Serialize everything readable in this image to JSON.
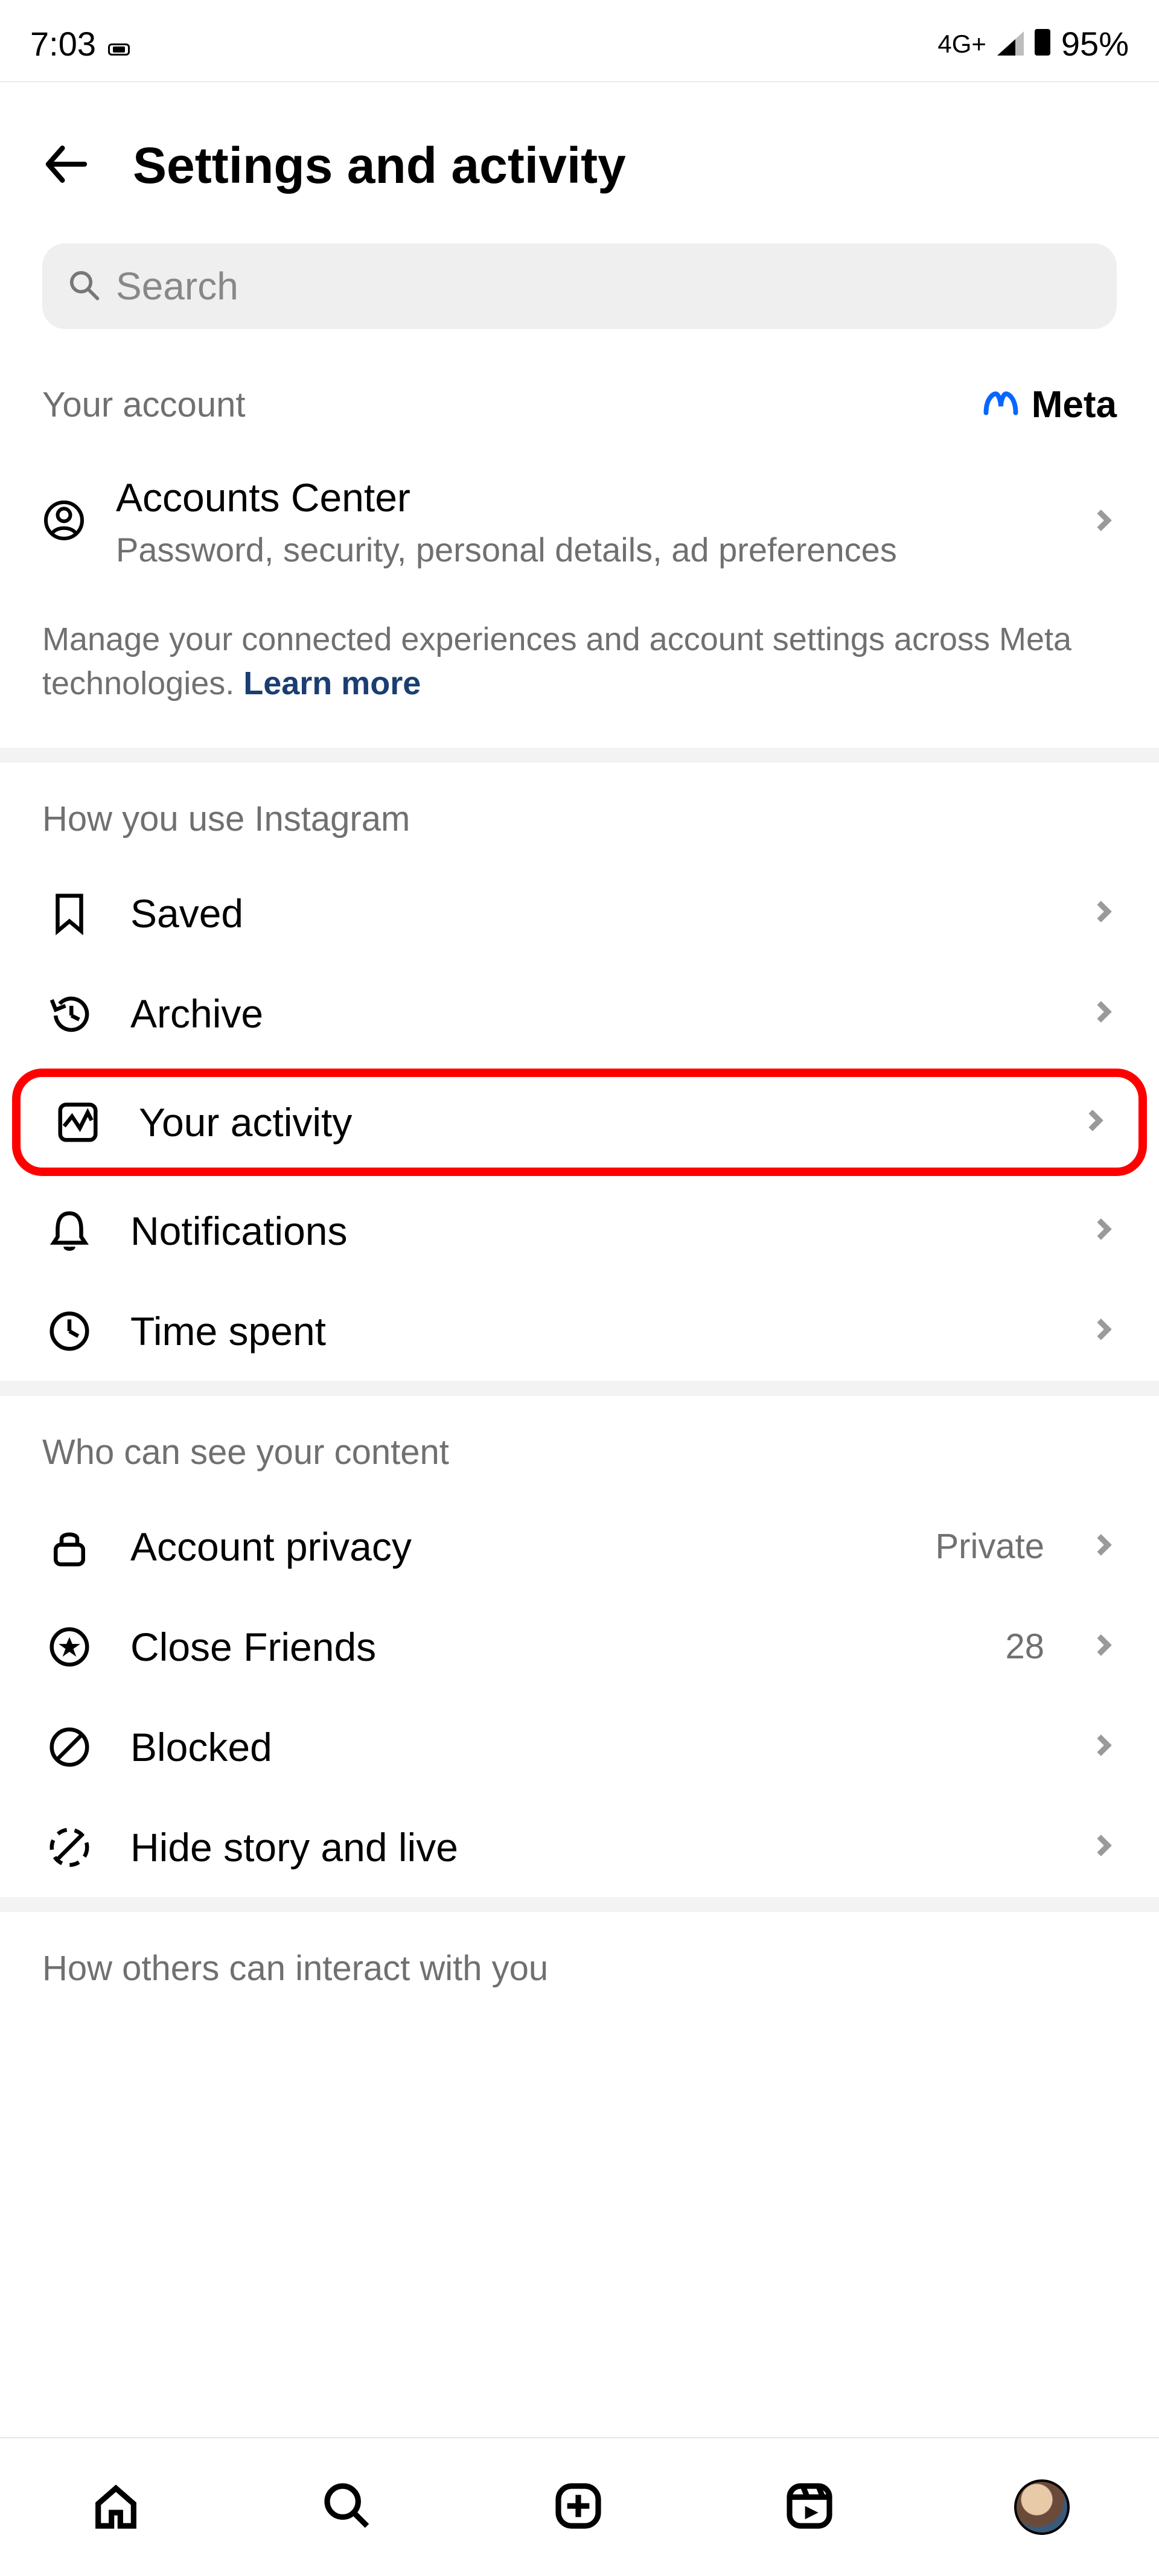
{
  "status": {
    "time": "7:03",
    "network_label": "4G+",
    "battery_pct": "95%"
  },
  "header": {
    "title": "Settings and activity"
  },
  "search": {
    "placeholder": "Search"
  },
  "account_section": {
    "label": "Your account",
    "brand": "Meta",
    "accounts_center": {
      "title": "Accounts Center",
      "subtitle": "Password, security, personal details, ad preferences"
    },
    "description": "Manage your connected experiences and account settings across Meta technologies. ",
    "learn_more": "Learn more"
  },
  "sections": [
    {
      "label": "How you use Instagram",
      "items": [
        {
          "icon": "bookmark",
          "label": "Saved",
          "value": ""
        },
        {
          "icon": "history",
          "label": "Archive",
          "value": ""
        },
        {
          "icon": "activity",
          "label": "Your activity",
          "value": "",
          "highlight": true
        },
        {
          "icon": "bell",
          "label": "Notifications",
          "value": ""
        },
        {
          "icon": "clock",
          "label": "Time spent",
          "value": ""
        }
      ]
    },
    {
      "label": "Who can see your content",
      "items": [
        {
          "icon": "lock",
          "label": "Account privacy",
          "value": "Private"
        },
        {
          "icon": "star-circle",
          "label": "Close Friends",
          "value": "28"
        },
        {
          "icon": "block",
          "label": "Blocked",
          "value": ""
        },
        {
          "icon": "hide-story",
          "label": "Hide story and live",
          "value": ""
        }
      ]
    },
    {
      "label": "How others can interact with you",
      "items": []
    }
  ]
}
